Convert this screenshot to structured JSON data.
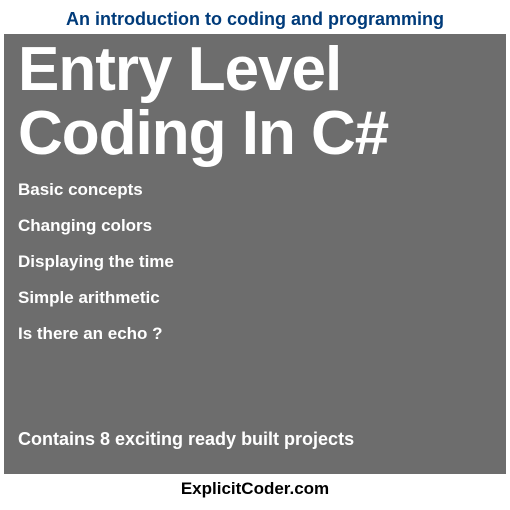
{
  "header": {
    "subtitle": "An introduction to coding and programming"
  },
  "main": {
    "title_line1": "Entry Level",
    "title_line2": "Coding In C#",
    "topics": [
      "Basic concepts",
      "Changing colors",
      "Displaying the time",
      "Simple arithmetic",
      "Is there an echo ?"
    ],
    "tagline": "Contains 8 exciting ready built projects"
  },
  "footer": {
    "brand": "ExplicitCoder.com"
  }
}
